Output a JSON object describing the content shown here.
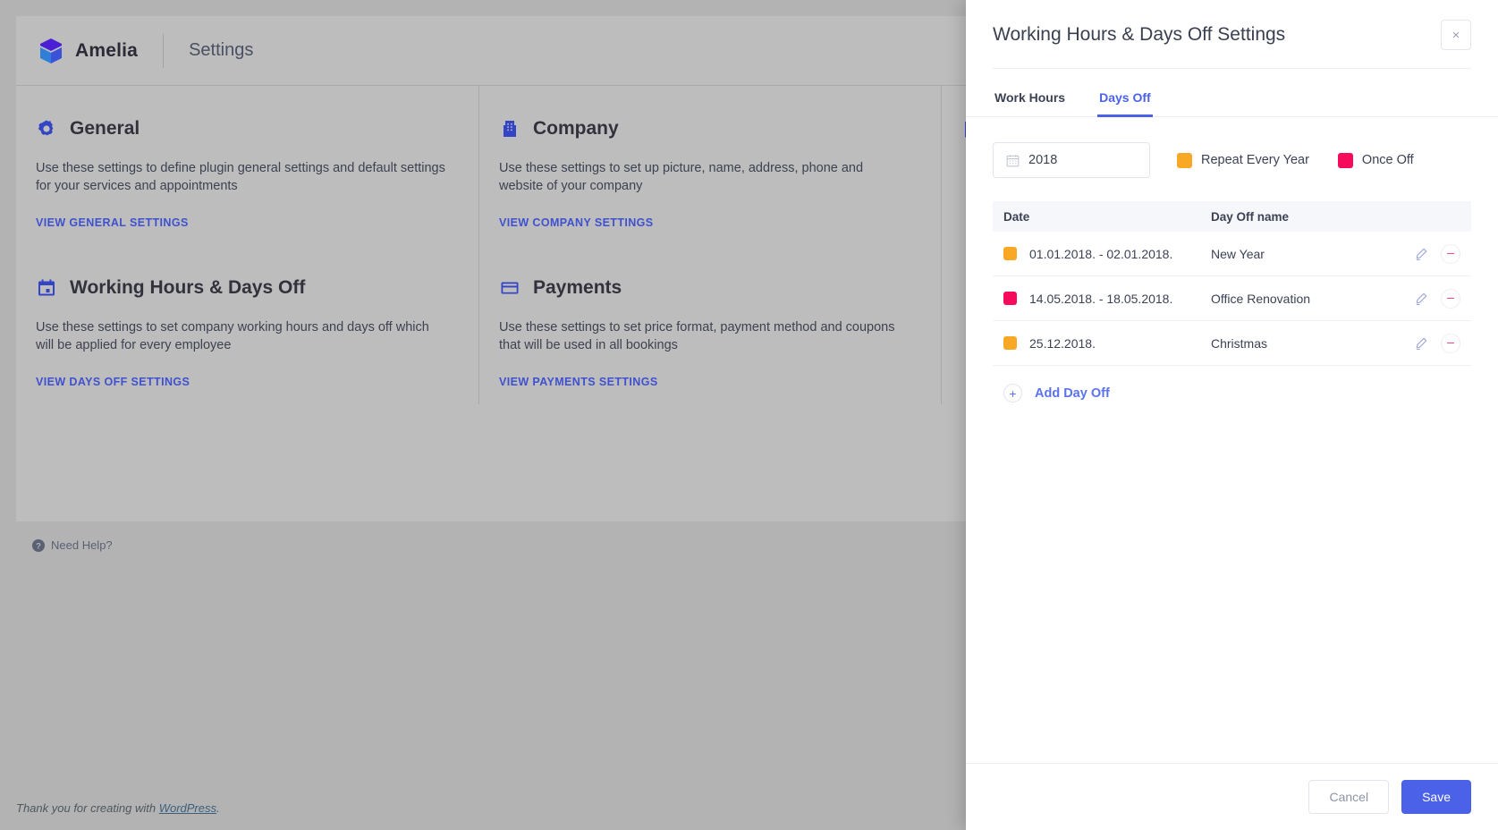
{
  "colors": {
    "accent": "#4b62e8",
    "link": "#3f51cf",
    "repeat_yearly": "#f9a825",
    "once_off": "#f50a5c",
    "icon_blue": "#3344c4"
  },
  "background_app": {
    "brand": {
      "name": "Amelia",
      "logo_icon": "amelia-cube-icon"
    },
    "section_title": "Settings",
    "cards": [
      {
        "icon": "gear-icon",
        "title": "General",
        "description": "Use these settings to define plugin general settings and default settings for your services and appointments",
        "link": "VIEW GENERAL SETTINGS"
      },
      {
        "icon": "building-icon",
        "title": "Company",
        "description": "Use these settings to set up picture, name, address, phone and website of your company",
        "link": "VIEW COMPANY SETTINGS"
      },
      {
        "icon": "calendar-icon",
        "title": "Working Hours & Days Off",
        "description": "Use these settings to set company working hours and days off which will be applied for every employee",
        "link": "VIEW DAYS OFF SETTINGS"
      },
      {
        "icon": "credit-card-icon",
        "title": "Payments",
        "description": "Use these settings to set price format, payment method and coupons that will be used in all bookings",
        "link": "VIEW PAYMENTS SETTINGS"
      }
    ],
    "need_help": "Need Help?",
    "footer": {
      "credit_prefix": "Thank you for creating with ",
      "credit_link": "WordPress",
      "credit_suffix": "."
    }
  },
  "panel": {
    "title": "Working Hours & Days Off Settings",
    "close_label": "×",
    "tabs": [
      {
        "label": "Work Hours",
        "active": false
      },
      {
        "label": "Days Off",
        "active": true
      }
    ],
    "year_field": {
      "value": "2018",
      "placeholder": "Year",
      "icon": "calendar-icon"
    },
    "legend": [
      {
        "label": "Repeat Every Year",
        "color": "#f9a825"
      },
      {
        "label": "Once Off",
        "color": "#f50a5c"
      }
    ],
    "table": {
      "columns": [
        "Date",
        "Day Off name"
      ],
      "rows": [
        {
          "color": "#f9a825",
          "date": "01.01.2018. - 02.01.2018.",
          "name": "New Year"
        },
        {
          "color": "#f50a5c",
          "date": "14.05.2018. - 18.05.2018.",
          "name": "Office Renovation"
        },
        {
          "color": "#f9a825",
          "date": "25.12.2018.",
          "name": "Christmas"
        }
      ]
    },
    "add_day_off": {
      "label": "Add Day Off",
      "icon": "plus-icon"
    },
    "footer": {
      "cancel": "Cancel",
      "save": "Save"
    }
  }
}
